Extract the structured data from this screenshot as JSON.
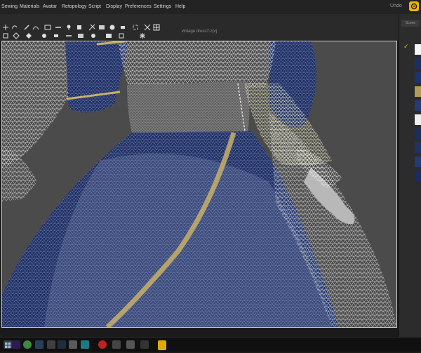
{
  "menubar": {
    "items": [
      "Sewing",
      "Materials",
      "Avatar",
      "Retopology",
      "Script",
      "Display",
      "Preferences",
      "Settings",
      "Help"
    ],
    "right_text": "Undo"
  },
  "document": {
    "file_name": "vintage dress7.zprj"
  },
  "right_panel": {
    "tab_label": "Scene",
    "swatches": [
      "#f5f5f5",
      "#1c2f63",
      "#1e3470",
      "#b39d56",
      "#263a75",
      "#f0f0f0",
      "#1c2d5e",
      "#1f3368",
      "#223a78",
      "#1b2d60"
    ],
    "selected_check": "✓"
  },
  "colors": {
    "accent": "#f0b400",
    "viewport_bg": "#4b4b4b",
    "dress_blue": "#1e2f66",
    "gold_stripe": "#c8b066",
    "white_mesh": "#e8e8e8"
  },
  "toolbar": {
    "icons": [
      "move-icon",
      "rotate-icon",
      "scale-icon",
      "transform-icon",
      "pencil-icon",
      "edit-curve-icon",
      "seam-icon",
      "segment-icon",
      "pin-icon",
      "point-icon",
      "tack-icon",
      "fold-icon",
      "line-icon",
      "button-icon",
      "buttonhole-icon",
      "topstitch-icon",
      "zipper-icon",
      "puckering-icon",
      "select-mesh-icon",
      "mesh-grid-icon",
      "anchor-icon",
      "arrange-icon",
      "fit-icon",
      "link-icon"
    ]
  },
  "taskbar": {
    "icons": [
      "windows-start-icon",
      "premiere-icon",
      "chrome-icon",
      "steam-icon",
      "photos-icon",
      "marvelous-icon",
      "app-icon-1",
      "app-icon-2",
      "app-icon-3",
      "app-icon-4",
      "marvelous-designer-icon"
    ]
  }
}
